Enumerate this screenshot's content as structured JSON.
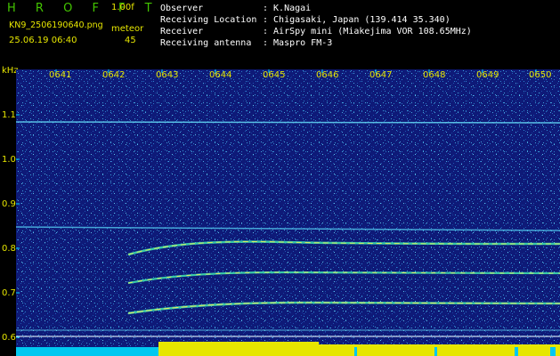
{
  "header": {
    "app_title": "H R O F F T",
    "version": "1.00f",
    "filename": "KN9_2506190640.png",
    "meteor_label": "meteor",
    "datetime": "25.06.19 06:40",
    "meteor_count": "45"
  },
  "info": [
    {
      "key": "Observer",
      "value": ": K.Nagai"
    },
    {
      "key": "Receiving Location",
      "value": ": Chigasaki, Japan (139.414 35.340)"
    },
    {
      "key": "Receiver",
      "value": ": AirSpy mini (Miakejima VOR 108.65MHz)"
    },
    {
      "key": "Receiving antenna",
      "value": ": Maspro FM-3"
    }
  ],
  "axis": {
    "y_unit": "kHz",
    "y_ticks": [
      "1.1",
      "1.0",
      "0.9",
      "0.8",
      "0.7",
      "0.6"
    ],
    "x_ticks": [
      "0641",
      "0642",
      "0643",
      "0644",
      "0645",
      "0646",
      "0647",
      "0648",
      "0649",
      "0650"
    ]
  },
  "colors": {
    "background": "#000000",
    "plot_bg": "#0d1770",
    "label_yellow": "#e6e600",
    "title_green": "#43c400",
    "info_white": "#ffffff",
    "tick_cyan": "#00d8ff"
  }
}
